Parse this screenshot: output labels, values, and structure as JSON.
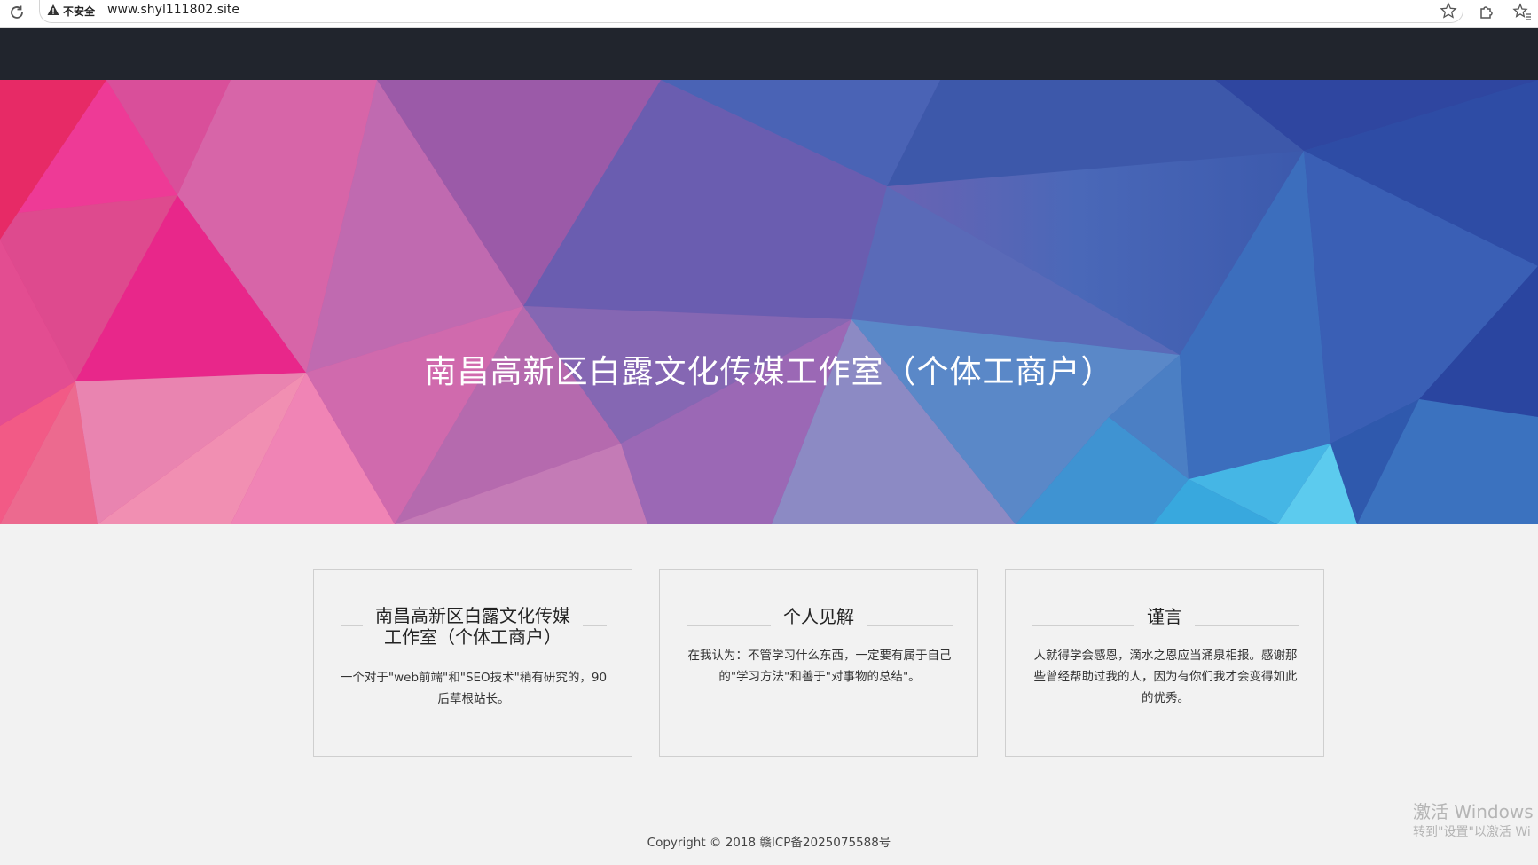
{
  "browser": {
    "security_label": "不安全",
    "url": "www.shyl111802.site",
    "icons": [
      "reload-icon",
      "warning-icon",
      "star-icon",
      "extensions-icon",
      "favorites-icon"
    ]
  },
  "hero": {
    "title": "南昌高新区白露文化传媒工作室（个体工商户）"
  },
  "cards": [
    {
      "title_line1": "南昌高新区白露文化传媒",
      "title_line2": "工作室（个体工商户）",
      "text": "一个对于\"web前端\"和\"SEO技术\"稍有研究的，90后草根站长。"
    },
    {
      "title": "个人见解",
      "text": "在我认为：不管学习什么东西，一定要有属于自己的\"学习方法\"和善于\"对事物的总结\"。"
    },
    {
      "title": "谨言",
      "text": "人就得学会感恩，滴水之恩应当涌泉相报。感谢那些曾经帮助过我的人，因为有你们我才会变得如此的优秀。"
    }
  ],
  "footer": {
    "copyright": "Copyright © 2018   赣ICP备2025075588号"
  },
  "watermark": {
    "line1": "激活 Windows",
    "line2": "转到\"设置\"以激活 Wi"
  },
  "colors": {
    "nav_bg": "#21252d",
    "page_bg": "#f2f2f2",
    "hero_left": "#e8317e",
    "hero_right": "#2d4aa0"
  }
}
